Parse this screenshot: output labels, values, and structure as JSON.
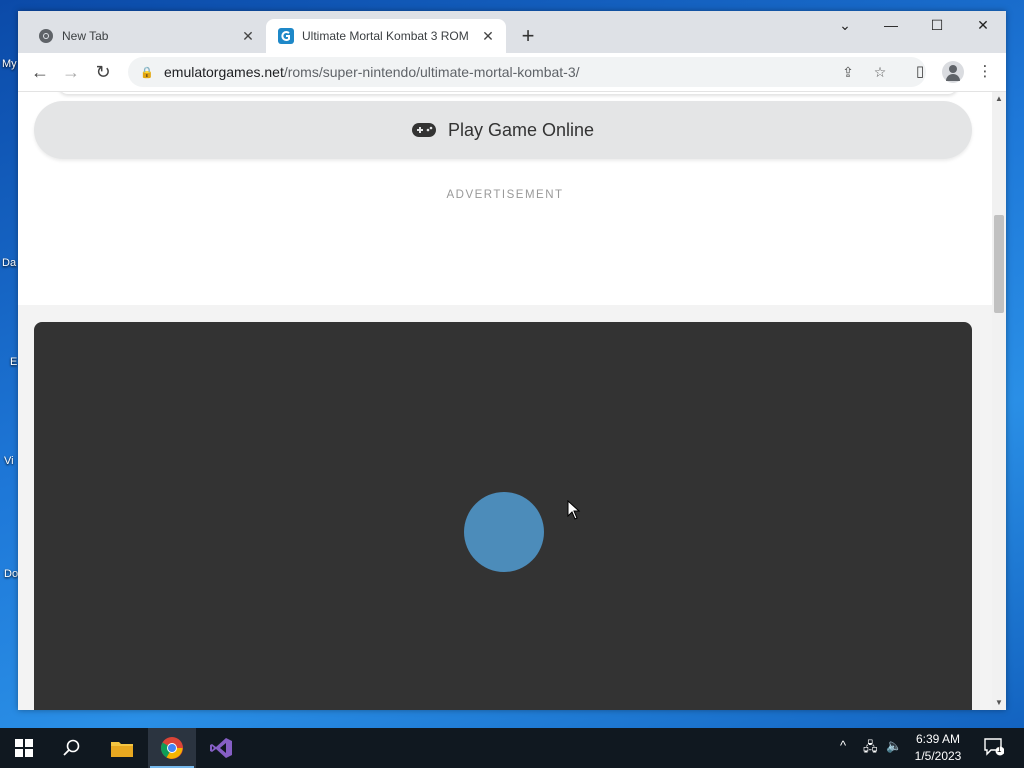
{
  "browser": {
    "tabs": [
      {
        "title": "New Tab",
        "icon": "chrome-icon",
        "active": false
      },
      {
        "title": "Ultimate Mortal Kombat 3 ROM",
        "icon": "emulatorgames-icon",
        "active": true
      }
    ],
    "url_host": "emulatorgames.net",
    "url_path": "/roms/super-nintendo/ultimate-mortal-kombat-3/"
  },
  "page": {
    "play_button_label": "Play Game Online",
    "advertisement_label": "ADVERTISEMENT"
  },
  "desktop": {
    "labels": [
      "My",
      "Da",
      "E",
      "Vi",
      "Do"
    ]
  },
  "taskbar": {
    "time": "6:39 AM",
    "date": "1/5/2023",
    "notification_count": "1"
  },
  "colors": {
    "game_background": "#333333",
    "loader": "#4c8cba",
    "accent_blue": "#1a73e8"
  }
}
